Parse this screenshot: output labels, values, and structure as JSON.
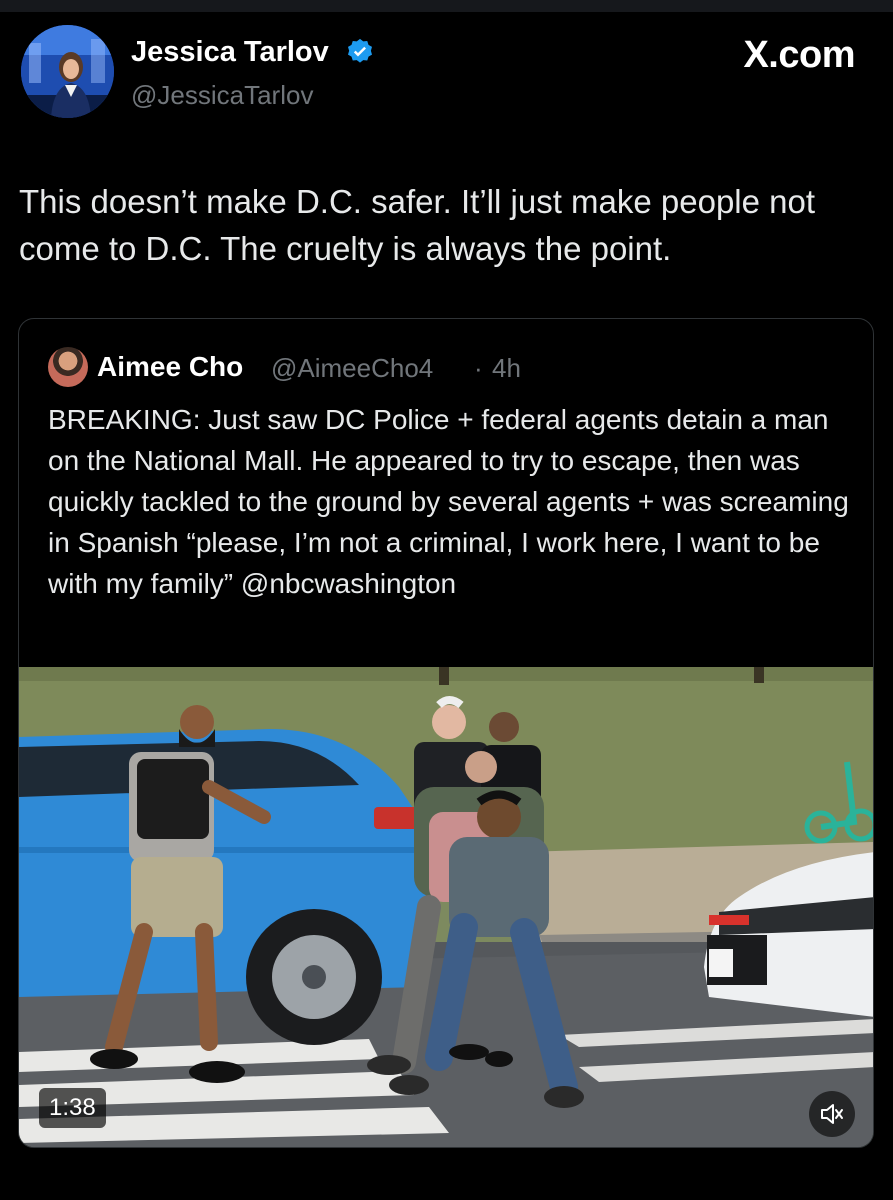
{
  "post": {
    "author_name": "Jessica Tarlov",
    "author_handle": "@JessicaTarlov",
    "verified": true,
    "brand": "X.com",
    "text": "This doesn’t make D.C. safer. It’ll just make people not come to D.C. The cruelty is always the point."
  },
  "quote": {
    "author_name": "Aimee Cho",
    "author_handle": "@AimeeCho4",
    "separator": "·",
    "time": "4h",
    "text": "BREAKING: Just saw DC Police + federal agents detain a man on the National Mall. He appeared to try to escape, then was quickly tackled to the ground by several agents + was screaming in Spanish “please, I’m not a criminal, I work here, I want to be with my family” @nbcwashington",
    "video": {
      "duration": "1:38",
      "muted": true
    }
  },
  "colors": {
    "background": "#000000",
    "text": "#e7e9ea",
    "secondary_text": "#71767b",
    "verified_badge": "#1d9bf0",
    "card_border": "#2f3336"
  },
  "icons": {
    "verified": "verified-badge-icon",
    "mute": "volume-muted-icon"
  }
}
